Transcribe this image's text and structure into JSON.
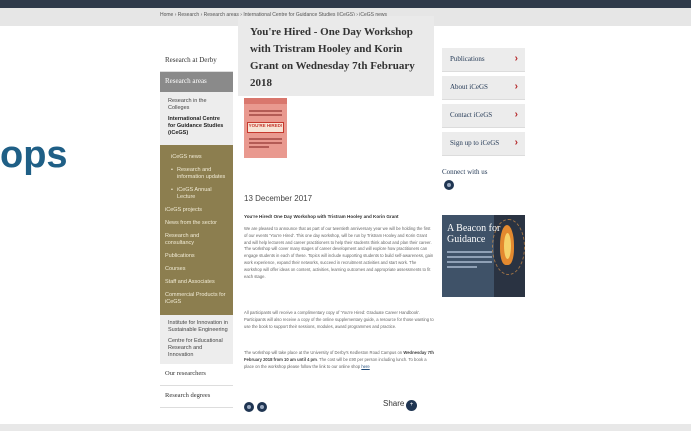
{
  "breadcrumb": "Home › Research › Research areas › International Centre for Guidance Studies (iCeGS) › iCeGS news",
  "partial_heading": "ops",
  "sidebar": {
    "research_at_derby": "Research at Derby",
    "research_areas": "Research areas",
    "colleges": "Research in the Colleges",
    "icegs": "International Centre for Guidance Studies (iCeGS)",
    "gold_items": [
      {
        "label": "iCeGS news"
      },
      {
        "label": "Research and information updates",
        "child": true
      },
      {
        "label": "iCeGS Annual Lecture",
        "child": true
      },
      {
        "label": "iCeGS projects"
      },
      {
        "label": "News from the sector"
      },
      {
        "label": "Research and consultancy"
      },
      {
        "label": "Publications"
      },
      {
        "label": "Courses"
      },
      {
        "label": "Staff and Associates"
      },
      {
        "label": "Commercial Products for iCeGS"
      }
    ],
    "bottom_items": [
      "Institute for Innovation in Sustainable Engineering",
      "Centre for Educational Research and Innovation"
    ],
    "our_researchers": "Our researchers",
    "research_degrees": "Research degrees"
  },
  "article": {
    "title": "You're Hired - One Day Workshop with Tristram Hooley and Korin Grant on Wednesday 7th February 2018",
    "poster_text": "YOU'RE HIRED!",
    "date": "13 December 2017",
    "subtitle": "You're Hired!  One Day Workshop with Tristram Hooley and Korin Grant",
    "p1": "We are pleased to announce that as part of our twentieth anniversary year we will be holding the first of our events 'You're Hired'.  This one day workshop, will be run by Tristram Hooley and Korin Grant and will help lecturers and career practitioners to help their students think about and plan their career. The workshop will cover many stages of career development and will explore how practitioners can engage students in each of these. Topics will include supporting students to build self-awareness, gain work experience, expand their networks, succeed in recruitment activities and start work. The workshop will offer ideas on content, activities, learning outcomes and appropriate assessments to fit each stage.",
    "p2": "All participants will receive a complimentary copy of 'You're Hired: Graduate Career Handbook'. Participants will also receive a copy of the online supplementary guide, a resource for those wanting to use the book to support their sessions, modules, award programmes and practice.",
    "p3_a": "The workshop will take place at the University of Derby's Kedleston Road Campus on ",
    "p3_b": "Wednesday 7th February 2018 from 10 am until 4 pm",
    "p3_c": ". The cost will be £90 per person including lunch. To book a place on the workshop please follow the link to our online shop ",
    "p3_link": "here",
    "share": "Share"
  },
  "right": {
    "links": [
      "Publications",
      "About iCeGS",
      "Contact iCeGS",
      "Sign up to iCeGS"
    ],
    "connect": "Connect with us",
    "banner_title": "A Beacon for Guidance"
  },
  "colors": {
    "sidebar_gold": "#8c7e4f",
    "chevron_red": "#b5282a",
    "navy": "#1f3552",
    "heading_blue": "#1f5f86"
  }
}
